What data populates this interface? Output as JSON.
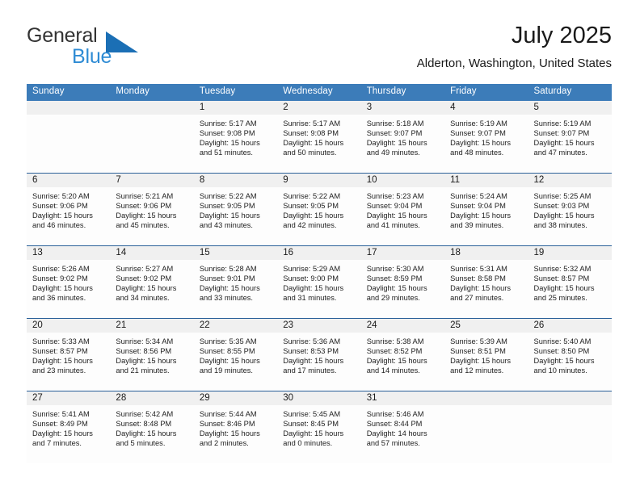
{
  "brand": {
    "name_part1": "General",
    "name_part2": "Blue",
    "triangle_color": "#1B6FB5",
    "blue_text_color": "#2E8BD4"
  },
  "header": {
    "title": "July 2025",
    "subtitle": "Alderton, Washington, United States",
    "accent_color": "#3C7CB9",
    "separator_color": "#2A6099",
    "band_color": "#F0F0F0"
  },
  "weekday_headers": [
    "Sunday",
    "Monday",
    "Tuesday",
    "Wednesday",
    "Thursday",
    "Friday",
    "Saturday"
  ],
  "weeks": [
    [
      {
        "day": "",
        "lines": []
      },
      {
        "day": "",
        "lines": []
      },
      {
        "day": "1",
        "lines": [
          "Sunrise: 5:17 AM",
          "Sunset: 9:08 PM",
          "Daylight: 15 hours",
          "and 51 minutes."
        ]
      },
      {
        "day": "2",
        "lines": [
          "Sunrise: 5:17 AM",
          "Sunset: 9:08 PM",
          "Daylight: 15 hours",
          "and 50 minutes."
        ]
      },
      {
        "day": "3",
        "lines": [
          "Sunrise: 5:18 AM",
          "Sunset: 9:07 PM",
          "Daylight: 15 hours",
          "and 49 minutes."
        ]
      },
      {
        "day": "4",
        "lines": [
          "Sunrise: 5:19 AM",
          "Sunset: 9:07 PM",
          "Daylight: 15 hours",
          "and 48 minutes."
        ]
      },
      {
        "day": "5",
        "lines": [
          "Sunrise: 5:19 AM",
          "Sunset: 9:07 PM",
          "Daylight: 15 hours",
          "and 47 minutes."
        ]
      }
    ],
    [
      {
        "day": "6",
        "lines": [
          "Sunrise: 5:20 AM",
          "Sunset: 9:06 PM",
          "Daylight: 15 hours",
          "and 46 minutes."
        ]
      },
      {
        "day": "7",
        "lines": [
          "Sunrise: 5:21 AM",
          "Sunset: 9:06 PM",
          "Daylight: 15 hours",
          "and 45 minutes."
        ]
      },
      {
        "day": "8",
        "lines": [
          "Sunrise: 5:22 AM",
          "Sunset: 9:05 PM",
          "Daylight: 15 hours",
          "and 43 minutes."
        ]
      },
      {
        "day": "9",
        "lines": [
          "Sunrise: 5:22 AM",
          "Sunset: 9:05 PM",
          "Daylight: 15 hours",
          "and 42 minutes."
        ]
      },
      {
        "day": "10",
        "lines": [
          "Sunrise: 5:23 AM",
          "Sunset: 9:04 PM",
          "Daylight: 15 hours",
          "and 41 minutes."
        ]
      },
      {
        "day": "11",
        "lines": [
          "Sunrise: 5:24 AM",
          "Sunset: 9:04 PM",
          "Daylight: 15 hours",
          "and 39 minutes."
        ]
      },
      {
        "day": "12",
        "lines": [
          "Sunrise: 5:25 AM",
          "Sunset: 9:03 PM",
          "Daylight: 15 hours",
          "and 38 minutes."
        ]
      }
    ],
    [
      {
        "day": "13",
        "lines": [
          "Sunrise: 5:26 AM",
          "Sunset: 9:02 PM",
          "Daylight: 15 hours",
          "and 36 minutes."
        ]
      },
      {
        "day": "14",
        "lines": [
          "Sunrise: 5:27 AM",
          "Sunset: 9:02 PM",
          "Daylight: 15 hours",
          "and 34 minutes."
        ]
      },
      {
        "day": "15",
        "lines": [
          "Sunrise: 5:28 AM",
          "Sunset: 9:01 PM",
          "Daylight: 15 hours",
          "and 33 minutes."
        ]
      },
      {
        "day": "16",
        "lines": [
          "Sunrise: 5:29 AM",
          "Sunset: 9:00 PM",
          "Daylight: 15 hours",
          "and 31 minutes."
        ]
      },
      {
        "day": "17",
        "lines": [
          "Sunrise: 5:30 AM",
          "Sunset: 8:59 PM",
          "Daylight: 15 hours",
          "and 29 minutes."
        ]
      },
      {
        "day": "18",
        "lines": [
          "Sunrise: 5:31 AM",
          "Sunset: 8:58 PM",
          "Daylight: 15 hours",
          "and 27 minutes."
        ]
      },
      {
        "day": "19",
        "lines": [
          "Sunrise: 5:32 AM",
          "Sunset: 8:57 PM",
          "Daylight: 15 hours",
          "and 25 minutes."
        ]
      }
    ],
    [
      {
        "day": "20",
        "lines": [
          "Sunrise: 5:33 AM",
          "Sunset: 8:57 PM",
          "Daylight: 15 hours",
          "and 23 minutes."
        ]
      },
      {
        "day": "21",
        "lines": [
          "Sunrise: 5:34 AM",
          "Sunset: 8:56 PM",
          "Daylight: 15 hours",
          "and 21 minutes."
        ]
      },
      {
        "day": "22",
        "lines": [
          "Sunrise: 5:35 AM",
          "Sunset: 8:55 PM",
          "Daylight: 15 hours",
          "and 19 minutes."
        ]
      },
      {
        "day": "23",
        "lines": [
          "Sunrise: 5:36 AM",
          "Sunset: 8:53 PM",
          "Daylight: 15 hours",
          "and 17 minutes."
        ]
      },
      {
        "day": "24",
        "lines": [
          "Sunrise: 5:38 AM",
          "Sunset: 8:52 PM",
          "Daylight: 15 hours",
          "and 14 minutes."
        ]
      },
      {
        "day": "25",
        "lines": [
          "Sunrise: 5:39 AM",
          "Sunset: 8:51 PM",
          "Daylight: 15 hours",
          "and 12 minutes."
        ]
      },
      {
        "day": "26",
        "lines": [
          "Sunrise: 5:40 AM",
          "Sunset: 8:50 PM",
          "Daylight: 15 hours",
          "and 10 minutes."
        ]
      }
    ],
    [
      {
        "day": "27",
        "lines": [
          "Sunrise: 5:41 AM",
          "Sunset: 8:49 PM",
          "Daylight: 15 hours",
          "and 7 minutes."
        ]
      },
      {
        "day": "28",
        "lines": [
          "Sunrise: 5:42 AM",
          "Sunset: 8:48 PM",
          "Daylight: 15 hours",
          "and 5 minutes."
        ]
      },
      {
        "day": "29",
        "lines": [
          "Sunrise: 5:44 AM",
          "Sunset: 8:46 PM",
          "Daylight: 15 hours",
          "and 2 minutes."
        ]
      },
      {
        "day": "30",
        "lines": [
          "Sunrise: 5:45 AM",
          "Sunset: 8:45 PM",
          "Daylight: 15 hours",
          "and 0 minutes."
        ]
      },
      {
        "day": "31",
        "lines": [
          "Sunrise: 5:46 AM",
          "Sunset: 8:44 PM",
          "Daylight: 14 hours",
          "and 57 minutes."
        ]
      },
      {
        "day": "",
        "lines": []
      },
      {
        "day": "",
        "lines": []
      }
    ]
  ]
}
